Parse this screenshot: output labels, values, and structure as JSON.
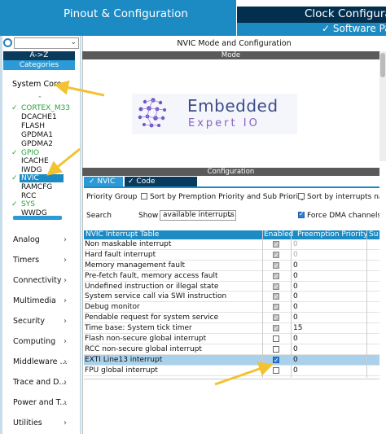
{
  "tabs": {
    "pinout": "Pinout & Configuration",
    "clock": "Clock Configurat",
    "software_packs": "✓ Software Pack"
  },
  "sidebar": {
    "sort_az": "A->Z",
    "categories": "Categories",
    "system_core": "System Core",
    "tree": [
      {
        "label": "CORTEX_M33",
        "checked": true
      },
      {
        "label": "DCACHE1",
        "checked": false
      },
      {
        "label": "FLASH",
        "checked": false
      },
      {
        "label": "GPDMA1",
        "checked": false
      },
      {
        "label": "GPDMA2",
        "checked": false
      },
      {
        "label": "GPIO",
        "checked": true
      },
      {
        "label": "ICACHE",
        "checked": false
      },
      {
        "label": "IWDG",
        "checked": false
      },
      {
        "label": "NVIC",
        "checked": true,
        "selected": true
      },
      {
        "label": "RAMCFG",
        "checked": false
      },
      {
        "label": "RCC",
        "checked": false
      },
      {
        "label": "SYS",
        "checked": true
      },
      {
        "label": "WWDG",
        "checked": false
      }
    ],
    "categories_list": [
      "Analog",
      "Timers",
      "Connectivity",
      "Multimedia",
      "Security",
      "Computing",
      "Middleware ...",
      "Trace and D...",
      "Power and T...",
      "Utilities"
    ]
  },
  "main": {
    "title": "NVIC Mode and Configuration",
    "mode_header": "Mode",
    "logo_line1": "Embedded",
    "logo_line2": "Expert IO",
    "config_header": "Configuration",
    "tab_nvic": "NVIC",
    "tab_code": "Code generation",
    "priority_group": "Priority Group",
    "sort_preemption": "Sort by Premption Priority and Sub Priority",
    "sort_interrupts": "Sort by interrupts nam",
    "search": "Search",
    "show": "Show",
    "show_value": "available interrupts",
    "force_dma": "Force DMA channels In",
    "table": {
      "headers": [
        "NVIC Interrupt Table",
        "Enabled",
        "Preemption Priority",
        "Su"
      ],
      "rows": [
        {
          "name": "Non maskable interrupt",
          "enabled": true,
          "locked": true,
          "priority": "0",
          "dim": true
        },
        {
          "name": "Hard fault interrupt",
          "enabled": true,
          "locked": true,
          "priority": "0",
          "dim": true
        },
        {
          "name": "Memory management fault",
          "enabled": true,
          "locked": true,
          "priority": "0",
          "dim": false
        },
        {
          "name": "Pre-fetch fault, memory access fault",
          "enabled": true,
          "locked": true,
          "priority": "0",
          "dim": false
        },
        {
          "name": "Undefined instruction or illegal state",
          "enabled": true,
          "locked": true,
          "priority": "0",
          "dim": false
        },
        {
          "name": "System service call via SWI instruction",
          "enabled": true,
          "locked": true,
          "priority": "0",
          "dim": false
        },
        {
          "name": "Debug monitor",
          "enabled": true,
          "locked": true,
          "priority": "0",
          "dim": false
        },
        {
          "name": "Pendable request for system service",
          "enabled": true,
          "locked": true,
          "priority": "0",
          "dim": false
        },
        {
          "name": "Time base: System tick timer",
          "enabled": true,
          "locked": true,
          "priority": "15",
          "dim": false
        },
        {
          "name": "Flash non-secure global interrupt",
          "enabled": false,
          "locked": false,
          "priority": "0",
          "dim": false
        },
        {
          "name": "RCC non-secure global interrupt",
          "enabled": false,
          "locked": false,
          "priority": "0",
          "dim": false
        },
        {
          "name": "EXTI Line13 interrupt",
          "enabled": true,
          "locked": false,
          "priority": "0",
          "dim": false,
          "highlight": true
        },
        {
          "name": "FPU global interrupt",
          "enabled": false,
          "locked": false,
          "priority": "0",
          "dim": false
        }
      ]
    }
  },
  "colors": {
    "tab_blue": "#1c8bc4",
    "tab_dark": "#032f4f",
    "check_green": "#2aa33b",
    "arrow_yellow": "#f2c230"
  }
}
